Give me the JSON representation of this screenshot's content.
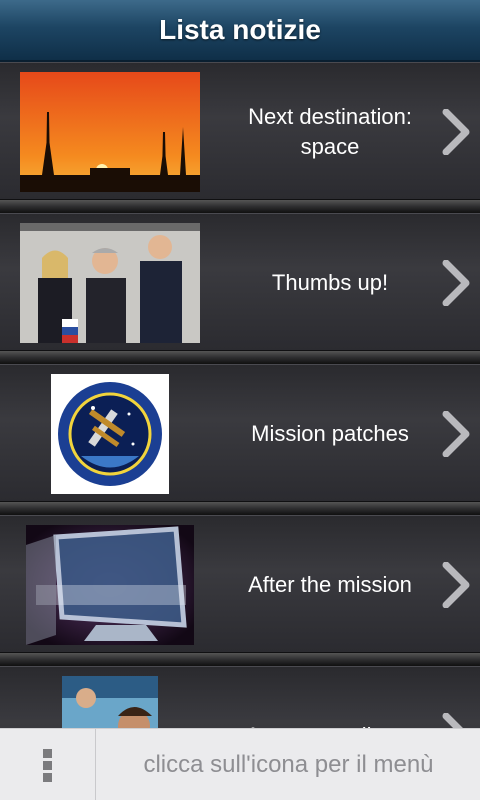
{
  "header": {
    "title": "Lista notizie"
  },
  "news": [
    {
      "title_line1": "Next destination:",
      "title_line2": "space",
      "thumb": "rocket-launch-sunset-image"
    },
    {
      "title": "Thumbs up!",
      "thumb": "astronauts-thumbs-up-image"
    },
    {
      "title": "Mission patches",
      "thumb": "soyuz-mission-patch-image"
    },
    {
      "title": "After the mission",
      "thumb": "in-bytes-video-image"
    },
    {
      "title": "Amateur radio on",
      "thumb": "amateur-radio-kids-image"
    }
  ],
  "bottom_bar": {
    "hint": "clicca sull'icona per il menù",
    "menu_icon": "overflow-menu-icon"
  },
  "colors": {
    "header": "#1d4563",
    "row": "#35353a",
    "bottom": "#ebebed"
  }
}
